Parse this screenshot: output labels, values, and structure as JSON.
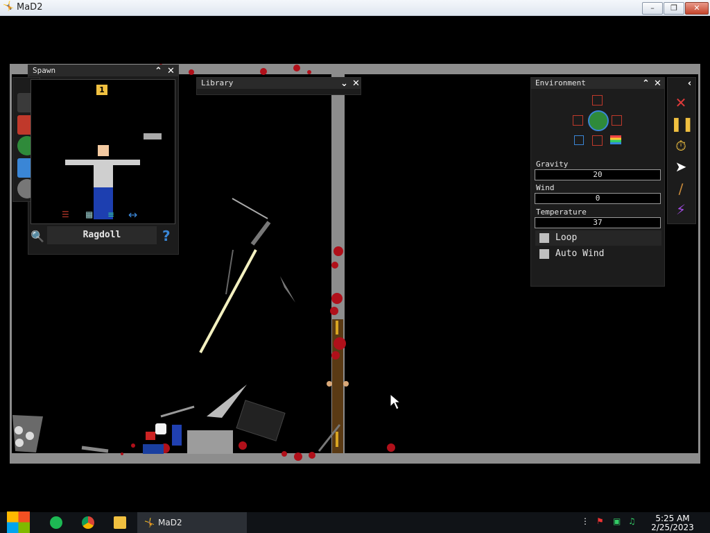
{
  "window": {
    "title": "MaD2",
    "controls": [
      "minimize",
      "maximize",
      "close"
    ]
  },
  "spawn_panel": {
    "title": "Spawn",
    "count_badge": "1",
    "selected_item": "Ragdoll",
    "help_label": "?",
    "categories": [
      "ragdoll-icon",
      "catalog-icon",
      "world-icon",
      "save-icon",
      "settings-icon"
    ]
  },
  "library_panel": {
    "title": "Library"
  },
  "environment_panel": {
    "title": "Environment",
    "gravity": {
      "label": "Gravity",
      "value": "20"
    },
    "wind": {
      "label": "Wind",
      "value": "0"
    },
    "temperature": {
      "label": "Temperature",
      "value": "37"
    },
    "options": [
      {
        "label": "Loop",
        "checked": false
      },
      {
        "label": "Auto Wind",
        "checked": false
      }
    ]
  },
  "toolbar": {
    "tools": [
      "clear-icon",
      "pause-icon",
      "stopwatch-icon",
      "pointer-icon",
      "knife-icon",
      "lightning-icon"
    ]
  },
  "taskbar": {
    "app_label": "MaD2",
    "time": "5:25 AM",
    "date": "2/25/2023"
  },
  "colors": {
    "accent": "#3a86d6",
    "blood": "#b0101a",
    "panel": "#1c1c1c",
    "wall": "#8d8d8d"
  }
}
